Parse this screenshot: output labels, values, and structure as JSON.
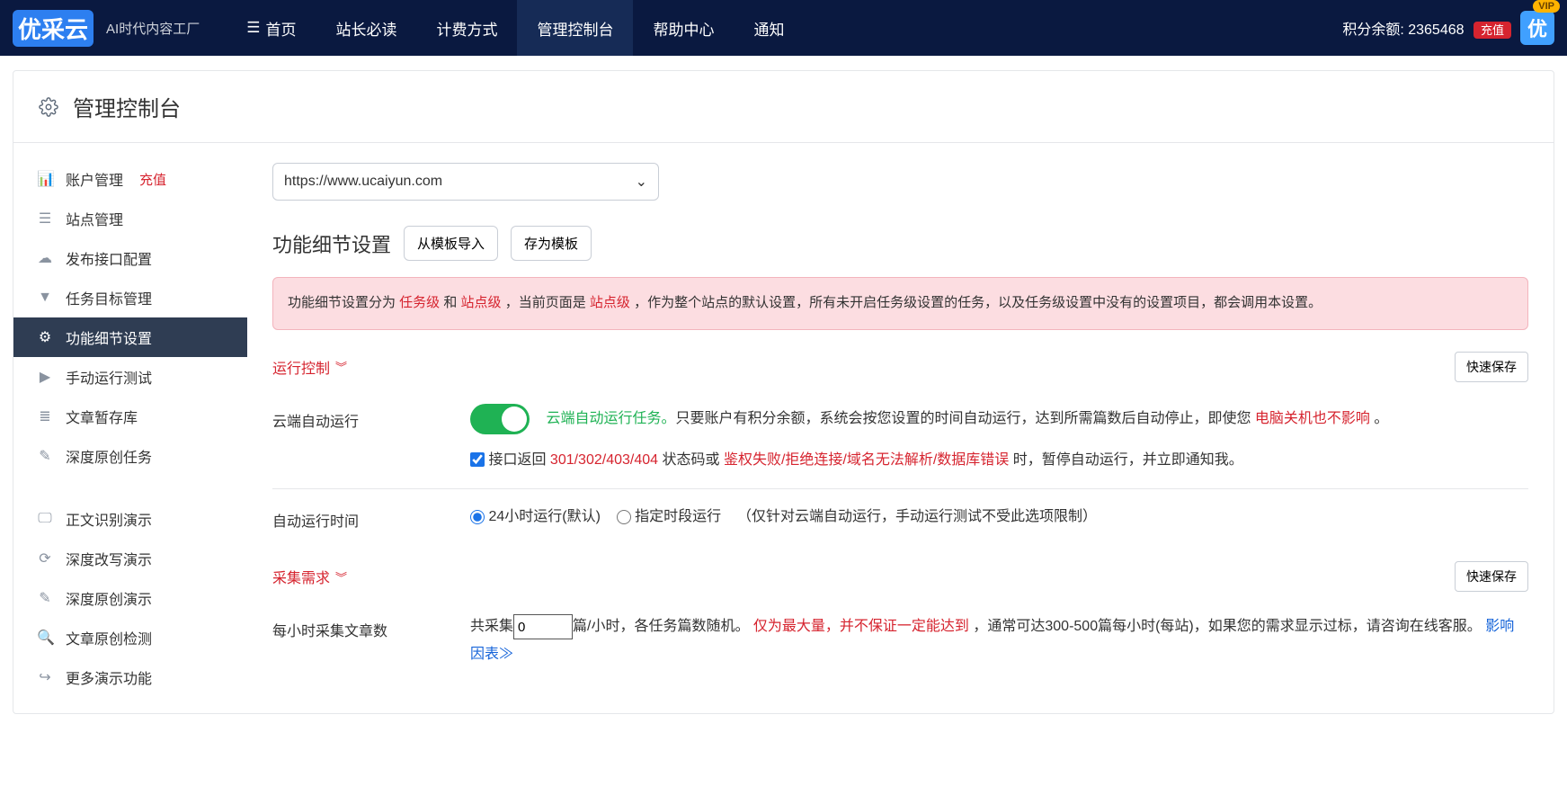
{
  "topnav": {
    "logo_main": "优采云",
    "logo_sub": "AI时代内容工厂",
    "items": [
      "首页",
      "站长必读",
      "计费方式",
      "管理控制台",
      "帮助中心",
      "通知"
    ],
    "active_index": 3,
    "points_label": "积分余额:",
    "points_value": "2365468",
    "recharge": "充值",
    "vip_label": "VIP",
    "vip_icon_text": "优"
  },
  "page_header": {
    "title": "管理控制台"
  },
  "sidebar": {
    "items": [
      {
        "label": "账户管理",
        "icon": "bar-chart-icon",
        "badge": "充值"
      },
      {
        "label": "站点管理",
        "icon": "list-icon"
      },
      {
        "label": "发布接口配置",
        "icon": "cloud-upload-icon"
      },
      {
        "label": "任务目标管理",
        "icon": "filter-icon"
      },
      {
        "label": "功能细节设置",
        "icon": "cogs-icon",
        "active": true
      },
      {
        "label": "手动运行测试",
        "icon": "play-icon"
      },
      {
        "label": "文章暂存库",
        "icon": "database-icon"
      },
      {
        "label": "深度原创任务",
        "icon": "edit-icon"
      }
    ],
    "demo_items": [
      {
        "label": "正文识别演示",
        "icon": "monitor-icon"
      },
      {
        "label": "深度改写演示",
        "icon": "refresh-icon"
      },
      {
        "label": "深度原创演示",
        "icon": "edit-icon"
      },
      {
        "label": "文章原创检测",
        "icon": "search-icon"
      },
      {
        "label": "更多演示功能",
        "icon": "share-icon"
      }
    ]
  },
  "site_select": {
    "value": "https://www.ucaiyun.com"
  },
  "detail": {
    "title": "功能细节设置",
    "btn_import": "从模板导入",
    "btn_save_tpl": "存为模板"
  },
  "alert": {
    "p1a": "功能细节设置分为 ",
    "lvl_task": "任务级",
    "p1b": " 和 ",
    "lvl_site": "站点级",
    "p1c": " ，当前页面是 ",
    "lvl_site2": "站点级",
    "p1d": " ，作为整个站点的默认设置，所有未开启任务级设置的任务，以及任务级设置中没有的设置项目，都会调用本设置。"
  },
  "grp_run": {
    "title": "运行控制",
    "quick_save": "快速保存",
    "auto_label": "云端自动运行",
    "auto_highlight": "云端自动运行任务。",
    "auto_desc1": "只要账户有积分余额，系统会按您设置的时间自动运行，达到所需篇数后自动停止，即使您",
    "auto_red": " 电脑关机也不影响 ",
    "auto_desc2": "。",
    "chk_label_a": "接口返回",
    "chk_codes": " 301/302/403/404 ",
    "chk_label_b": "状态码或",
    "chk_errors": " 鉴权失败/拒绝连接/域名无法解析/数据库错误 ",
    "chk_label_c": "时，暂停自动运行，并立即通知我。",
    "time_label": "自动运行时间",
    "time_opt1": "24小时运行(默认)",
    "time_opt2": "指定时段运行",
    "time_hint": "（仅针对云端自动运行，手动运行测试不受此选项限制）"
  },
  "grp_need": {
    "title": "采集需求",
    "quick_save": "快速保存",
    "hourly_label": "每小时采集文章数",
    "hourly_a": "共采集",
    "hourly_value": "0",
    "hourly_b": "篇/小时，各任务篇数随机。",
    "hourly_red": " 仅为最大量，并不保证一定能达到 ",
    "hourly_c": "，通常可达300-500篇每小时(每站)，如果您的需求显示过标，请咨询在线客服。",
    "hourly_link": "影响因表≫"
  }
}
